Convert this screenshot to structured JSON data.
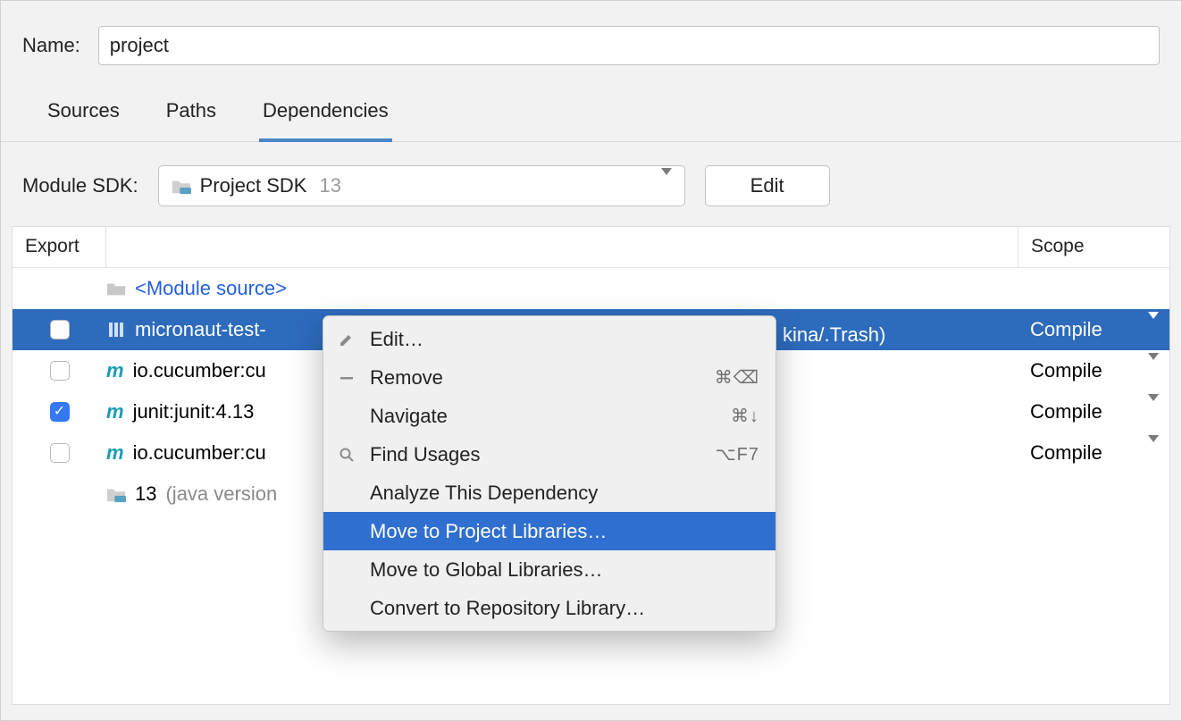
{
  "form": {
    "name_label": "Name:",
    "name_value": "project"
  },
  "tabs": {
    "sources": "Sources",
    "paths": "Paths",
    "dependencies": "Dependencies"
  },
  "sdk": {
    "label": "Module SDK:",
    "selected_name": "Project SDK",
    "selected_version": "13",
    "edit_button": "Edit"
  },
  "table": {
    "header_export": "Export",
    "header_scope": "Scope",
    "rows": {
      "module_source": "<Module source>",
      "r1_name_part": "micronaut-test-",
      "r1_path_tail": "kina/.Trash)",
      "r1_scope": "Compile",
      "r2_name": "io.cucumber:cu",
      "r2_scope": "Compile",
      "r3_name": "junit:junit:4.13",
      "r3_scope": "Compile",
      "r4_name": "io.cucumber:cu",
      "r4_scope": "Compile",
      "r5_prefix": "13",
      "r5_suffix": "(java version"
    }
  },
  "menu": {
    "edit": "Edit…",
    "remove": "Remove",
    "remove_shortcut": "⌘⌫",
    "navigate": "Navigate",
    "navigate_shortcut": "⌘↓",
    "find_usages": "Find Usages",
    "find_usages_shortcut": "⌥F7",
    "analyze": "Analyze This Dependency",
    "move_project": "Move to Project Libraries…",
    "move_global": "Move to Global Libraries…",
    "convert_repo": "Convert to Repository Library…"
  }
}
